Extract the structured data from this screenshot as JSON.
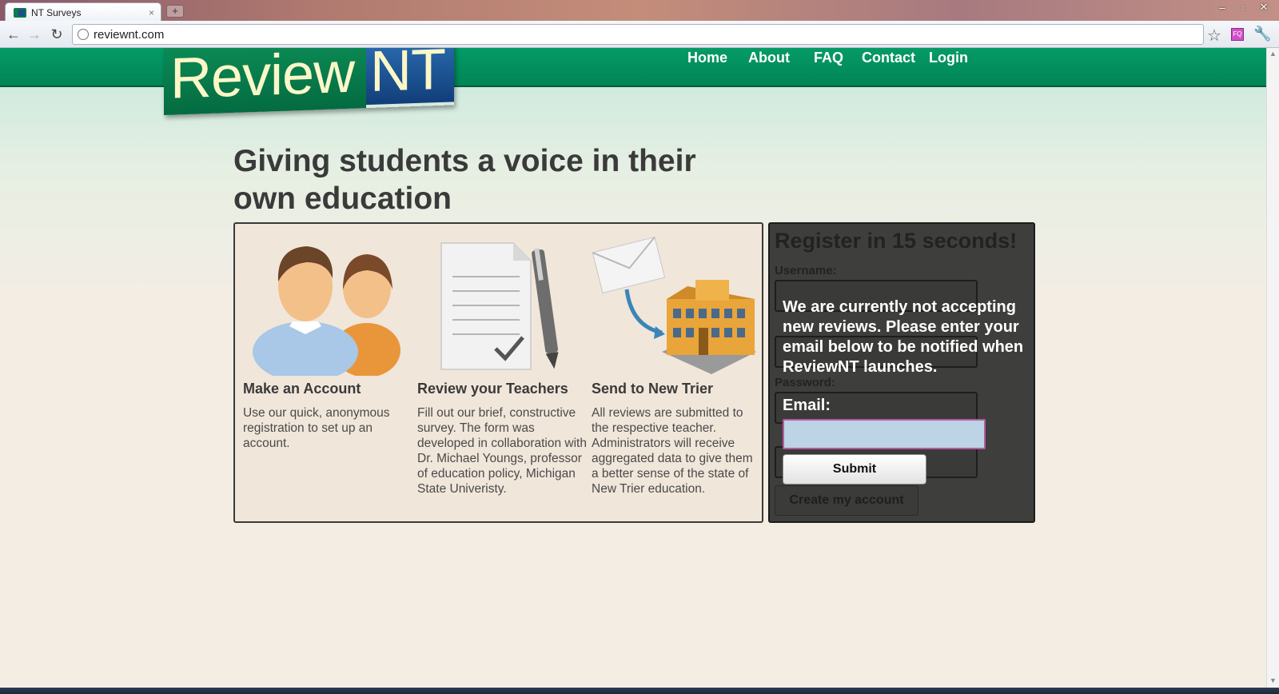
{
  "browser": {
    "tab_title": "NT Surveys",
    "tab_close": "×",
    "new_tab": "+",
    "url": "reviewnt.com",
    "window_controls": {
      "minimize": "–",
      "maximize": "▫",
      "close": "✕"
    }
  },
  "site": {
    "logo_part_a": "Review",
    "logo_part_b": "NT",
    "nav": {
      "home": "Home",
      "about": "About",
      "faq": "FAQ",
      "contact": "Contact",
      "login": "Login"
    },
    "headline": "Giving students a voice in their own education"
  },
  "features": [
    {
      "title": "Make an Account",
      "body": "Use our quick, anonymous registration to set up an account.",
      "icon": "people-icon"
    },
    {
      "title": "Review your Teachers",
      "body": "Fill out our brief, constructive survey. The form was developed in collaboration with Dr. Michael Youngs, professor of education policy, Michigan State Univeristy.",
      "icon": "document-pen-icon"
    },
    {
      "title": "Send to New Trier",
      "body": "All reviews are submitted to the respective teacher. Administrators will receive aggregated data to give them a better sense of the state of New Trier education.",
      "icon": "envelope-school-icon"
    }
  ],
  "register": {
    "title": "Register in 15 seconds!",
    "username_label": "Username:",
    "password_label": "Password:",
    "create_button": "Create my account",
    "notice": "We are currently not accepting new reviews. Please enter your email below to be notified when ReviewNT launches.",
    "email_label": "Email:",
    "email_value": "",
    "submit_button": "Submit"
  }
}
